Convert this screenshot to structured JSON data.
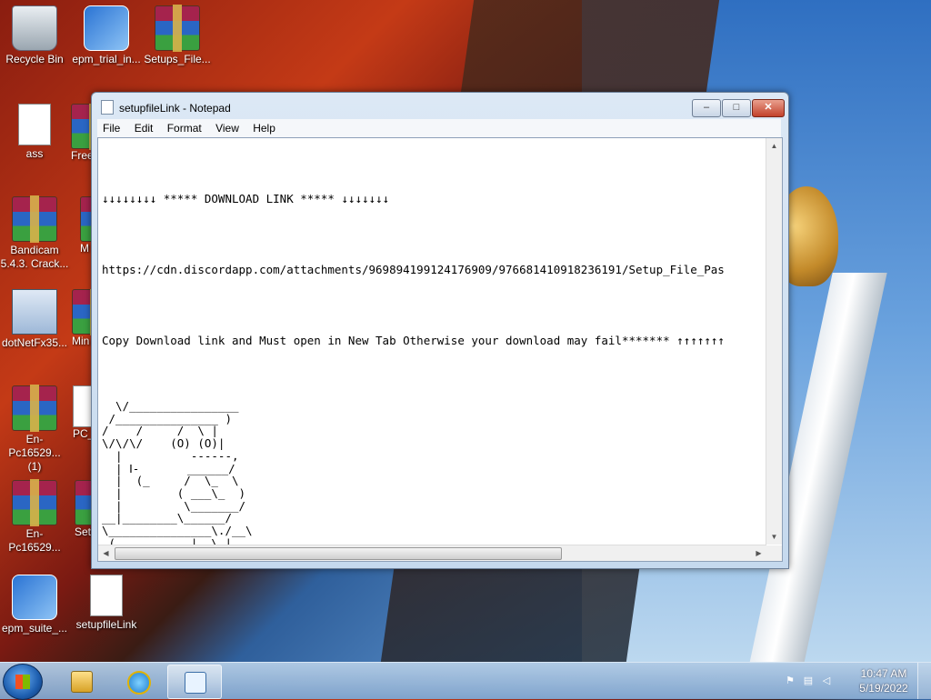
{
  "desktop": {
    "icons": [
      {
        "label": "Recycle Bin",
        "icon": "recycle-bin-icon"
      },
      {
        "label": "epm_trial_in...",
        "icon": "installer-icon"
      },
      {
        "label": "Setups_File...",
        "icon": "winrar-archive-icon"
      },
      {
        "label": "ass",
        "icon": "text-file-icon"
      },
      {
        "label": "Free",
        "icon": "winrar-archive-icon"
      },
      {
        "label": "Bandicam\n5.4.3. Crack...",
        "icon": "winrar-archive-icon"
      },
      {
        "label": "M",
        "icon": "winrar-archive-icon"
      },
      {
        "label": "dotNetFx35...",
        "icon": "dotnet-installer-icon"
      },
      {
        "label": "Min",
        "icon": "winrar-archive-icon"
      },
      {
        "label": "En-Pc16529...\n(1)",
        "icon": "winrar-archive-icon"
      },
      {
        "label": "PC_",
        "icon": "text-file-icon"
      },
      {
        "label": "En-Pc16529...",
        "icon": "winrar-archive-icon"
      },
      {
        "label": "Set",
        "icon": "winrar-archive-icon"
      },
      {
        "label": "epm_suite_...",
        "icon": "installer-icon"
      },
      {
        "label": "setupfileLink",
        "icon": "text-file-icon"
      }
    ]
  },
  "notepad": {
    "title": "setupfileLink - Notepad",
    "menu": [
      "File",
      "Edit",
      "Format",
      "View",
      "Help"
    ],
    "lines": [
      "↓↓↓↓↓↓↓↓ ***** DOWNLOAD LINK ***** ↓↓↓↓↓↓↓",
      "https://cdn.discordapp.com/attachments/969894199124176909/976681410918236191/Setup_File_Pas",
      "Copy Download link and Must open in New Tab Otherwise your download may fail******* ↑↑↑↑↑↑↑"
    ],
    "ascii_art": "  \\/________________\n /_______________ )\n/    /     /  \\ |\n\\/\\/\\/    (O) (O)|\n  |          ------,\n  | Ⅰ-       ______/\n  |  (_     /  \\_  \\\n  |        ( ___\\_  )\n  |         \\_______/\n__|________\\______/\n\\_______________\\./__\\\n (     .     |  \\ |\n  (   /_\\  .   |  \\|\n  |`\\     /_\\ |   \\| \\(\"",
    "buttons": {
      "minimize": "–",
      "maximize": "□",
      "close": "✕"
    }
  },
  "taskbar": {
    "apps": [
      {
        "name": "windows-explorer",
        "icon": "folder-icon"
      },
      {
        "name": "internet-explorer",
        "icon": "internet-explorer-icon"
      },
      {
        "name": "notepad",
        "icon": "notepad-icon",
        "active": true
      }
    ],
    "tray_icons": [
      "flag-icon",
      "network-icon",
      "volume-icon"
    ],
    "time": "10:47 AM",
    "date": "5/19/2022"
  }
}
